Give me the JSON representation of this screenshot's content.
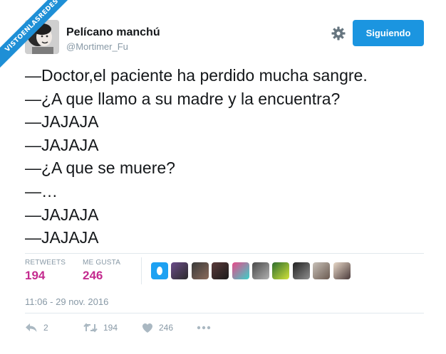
{
  "watermark": "VISTOENLASREDES",
  "user": {
    "name": "Pelícano manchú",
    "handle": "@Mortimer_Fu",
    "avatar_icon": "user-avatar-photo"
  },
  "follow_button": {
    "label": "Siguiendo",
    "color": "#1b95e0"
  },
  "settings_icon": "gear-icon",
  "tweet": {
    "lines": [
      "—Doctor,el paciente ha perdido mucha sangre.",
      "—¿A que llamo a su madre y la encuentra?",
      "—JAJAJA",
      "—JAJAJA",
      "—¿A que se muere?",
      "—…",
      "—JAJAJA",
      "—JAJAJA"
    ]
  },
  "stats": {
    "retweets_label": "RETWEETS",
    "retweets": "194",
    "likes_label": "ME GUSTA",
    "likes": "246",
    "count_color": "#c42b8f"
  },
  "likers": [
    {
      "name": "liker-avatar-1",
      "c1": "#1da1f2",
      "c2": "#ffffff"
    },
    {
      "name": "liker-avatar-2",
      "c1": "#6b4c8a",
      "c2": "#2b2b2b"
    },
    {
      "name": "liker-avatar-3",
      "c1": "#3a3a3a",
      "c2": "#8a6a5a"
    },
    {
      "name": "liker-avatar-4",
      "c1": "#5a3a3a",
      "c2": "#1c1c1c"
    },
    {
      "name": "liker-avatar-5",
      "c1": "#e84a8a",
      "c2": "#3ad0c8"
    },
    {
      "name": "liker-avatar-6",
      "c1": "#4a4a4a",
      "c2": "#b0b0b0"
    },
    {
      "name": "liker-avatar-7",
      "c1": "#2e6e2e",
      "c2": "#d2e23a"
    },
    {
      "name": "liker-avatar-8",
      "c1": "#222222",
      "c2": "#8e8e8e"
    },
    {
      "name": "liker-avatar-9",
      "c1": "#c8c0b8",
      "c2": "#6a5a50"
    },
    {
      "name": "liker-avatar-10",
      "c1": "#e8d8c8",
      "c2": "#4a3a3a"
    }
  ],
  "timestamp": "11:06 - 29 nov. 2016",
  "actions": {
    "reply_icon": "reply-icon",
    "reply_count": "2",
    "retweet_icon": "retweet-icon",
    "retweet_count": "194",
    "like_icon": "heart-icon",
    "like_count": "246",
    "more_icon": "more-icon"
  }
}
